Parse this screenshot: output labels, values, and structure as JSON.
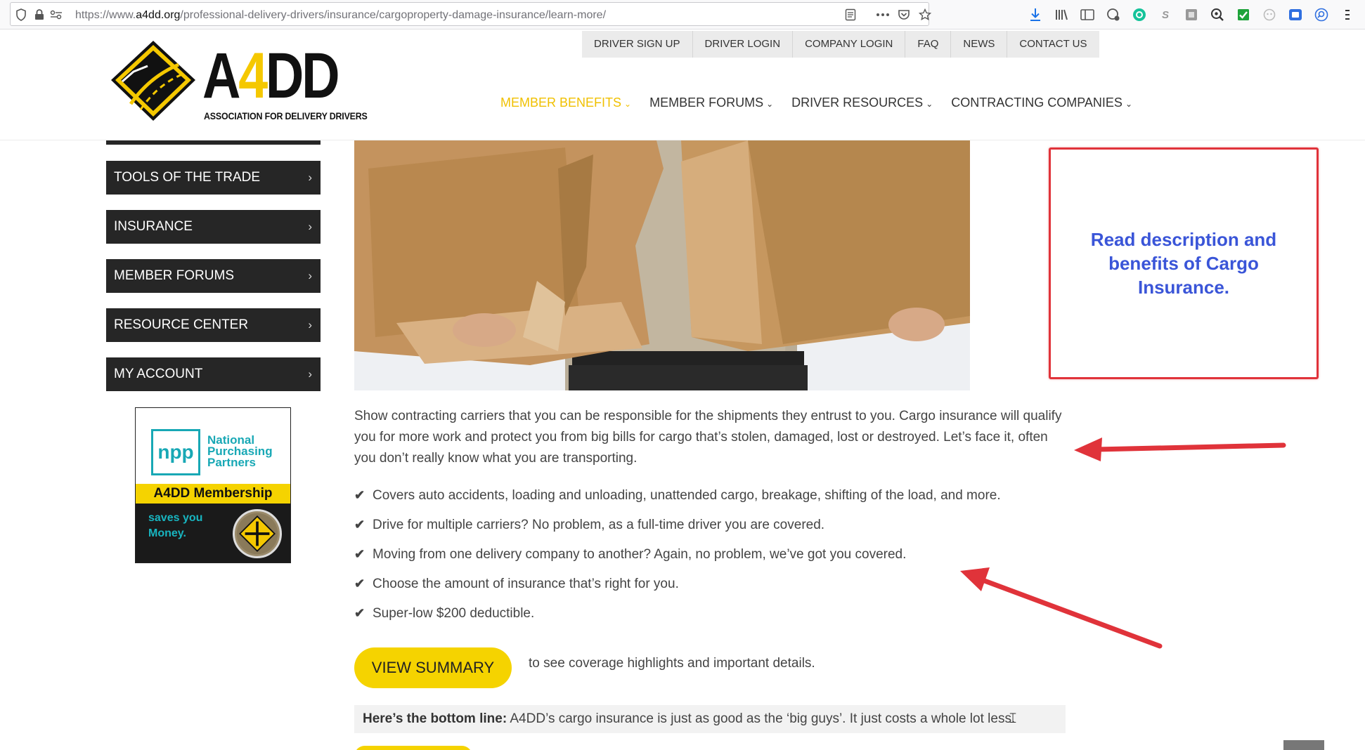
{
  "browser": {
    "url_prefix": "https://www.",
    "url_domain": "a4dd.org",
    "url_path": "/professional-delivery-drivers/insurance/cargoproperty-damage-insurance/learn-more/"
  },
  "top_links": [
    "DRIVER SIGN UP",
    "DRIVER LOGIN",
    "COMPANY LOGIN",
    "FAQ",
    "NEWS",
    "CONTACT US"
  ],
  "logo": {
    "text_a": "A",
    "text_4": "4",
    "text_dd": "DD",
    "tagline": "ASSOCIATION FOR DELIVERY DRIVERS"
  },
  "main_nav": [
    {
      "label": "MEMBER BENEFITS",
      "active": true
    },
    {
      "label": "MEMBER FORUMS",
      "active": false
    },
    {
      "label": "DRIVER RESOURCES",
      "active": false
    },
    {
      "label": "CONTRACTING COMPANIES",
      "active": false
    }
  ],
  "sidebar": {
    "items": [
      "TOOLS OF THE TRADE",
      "INSURANCE",
      "MEMBER FORUMS",
      "RESOURCE CENTER",
      "MY ACCOUNT"
    ],
    "arrow": "›"
  },
  "ad": {
    "npp": "npp",
    "name_line1": "National",
    "name_line2": "Purchasing",
    "name_line3": "Partners",
    "band": "A4DD Membership",
    "saves_line1": "saves you",
    "saves_line2": "Money."
  },
  "content": {
    "description": "Show contracting carriers that you can be responsible for the shipments they entrust to you.  Cargo insurance will qualify you for more work and protect you from big bills for cargo that’s stolen, damaged, lost or destroyed.  Let’s face it, often you don’t really know what you are transporting.",
    "benefits": [
      "Covers auto accidents, loading and unloading, unattended cargo, breakage, shifting of the load, and more.",
      "Drive for multiple carriers? No problem, as a full-time driver you are covered.",
      "Moving from one delivery company to another? Again, no problem, we’ve got you covered.",
      "Choose the amount of insurance that’s right for you.",
      "Super-low $200 deductible."
    ],
    "view_summary_label": "VIEW SUMMARY",
    "summary_note": "to see coverage highlights and important details.",
    "bottom_line_bold": "Here’s the bottom line:",
    "bottom_line_text": " A4DD’s cargo insurance is just as good as the ‘big guys’. It just costs a whole lot less."
  },
  "callout": {
    "text": "Read description and benefits of Cargo Insurance."
  },
  "colors": {
    "accent_yellow": "#f5d300",
    "nav_active": "#f0c000",
    "sidebar_bg": "#262626",
    "annotation_red": "#e0333a",
    "annotation_blue": "#3a55d8",
    "npp_teal": "#18a8b5"
  }
}
